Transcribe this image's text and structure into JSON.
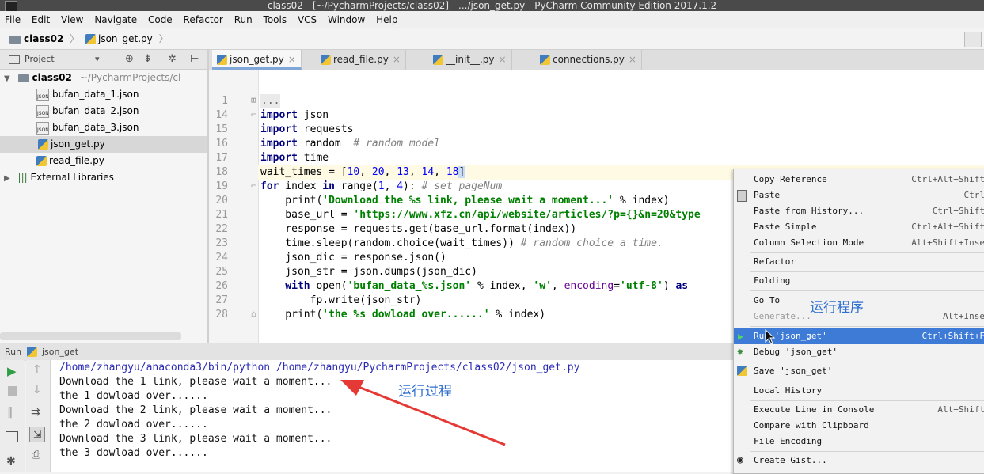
{
  "window": {
    "title": "class02 - [~/PycharmProjects/class02] - .../json_get.py - PyCharm Community Edition 2017.1.2"
  },
  "menu": [
    "File",
    "Edit",
    "View",
    "Navigate",
    "Code",
    "Refactor",
    "Run",
    "Tools",
    "VCS",
    "Window",
    "Help"
  ],
  "breadcrumb": {
    "project": "class02",
    "file": "json_get.py"
  },
  "project_panel": {
    "title": "Project",
    "root": "class02",
    "root_path": "~/PycharmProjects/cl",
    "files": [
      "bufan_data_1.json",
      "bufan_data_2.json",
      "bufan_data_3.json",
      "json_get.py",
      "read_file.py"
    ],
    "external": "External Libraries"
  },
  "tabs": [
    "json_get.py",
    "read_file.py",
    "__init__.py",
    "connections.py"
  ],
  "editor": {
    "line_numbers": [
      "1",
      "14",
      "15",
      "16",
      "17",
      "18",
      "19",
      "20",
      "21",
      "22",
      "23",
      "24",
      "25",
      "26",
      "27",
      "28"
    ],
    "fold": "...",
    "l14": {
      "kw": "import",
      "rest": " json"
    },
    "l15": {
      "kw": "import",
      "rest": " requests"
    },
    "l16": {
      "kw": "import",
      "rest": " random  ",
      "cmt": "# random model"
    },
    "l17": {
      "kw": "import",
      "rest": " time"
    },
    "l18": {
      "a": "wait_times = [",
      "n1": "10",
      "c1": ", ",
      "n2": "20",
      "c2": ", ",
      "n3": "13",
      "c3": ", ",
      "n4": "14",
      "c4": ", ",
      "n5": "18",
      "end": "]"
    },
    "l19": {
      "kw1": "for",
      "a": " index ",
      "kw2": "in",
      "b": " range(",
      "n1": "1",
      "c": ", ",
      "n2": "4",
      "d": "): ",
      "cmt": "# set pageNum"
    },
    "l20": {
      "a": "    print(",
      "s": "'Download the %s link, please wait a moment...'",
      "b": " % index)"
    },
    "l21": {
      "a": "    base_url = ",
      "s": "'https://www.xfz.cn/api/website/articles/?p={}&n=20&type"
    },
    "l22": "    response = requests.get(base_url.format(index))",
    "l23": {
      "a": "    time.sleep(random.choice(wait_times)) ",
      "cmt": "# random choice a time."
    },
    "l24": "    json_dic = response.json()",
    "l25": "    json_str = json.dumps(json_dic)",
    "l26": {
      "kw": "    with",
      "a": " open(",
      "s1": "'bufan_data_%s.json'",
      "b": " % index, ",
      "s2": "'w'",
      "c": ", ",
      "kwarg": "encoding",
      "d": "=",
      "s3": "'utf-8'",
      "e": ") ",
      "kw2": "as"
    },
    "l27": "        fp.write(json_str)",
    "l28": {
      "a": "    print(",
      "s": "'the %s dowload over......'",
      "b": " % index)"
    }
  },
  "run": {
    "title": "Run",
    "config": "json_get",
    "lines": [
      "/home/zhangyu/anaconda3/bin/python /home/zhangyu/PycharmProjects/class02/json_get.py",
      "Download the 1 link, please wait a moment...",
      "the 1 dowload over......",
      "Download the 2 link, please wait a moment...",
      "the 2 dowload over......",
      "Download the 3 link, please wait a moment...",
      "the 3 dowload over......"
    ]
  },
  "context_menu": {
    "items": [
      {
        "label": "Copy Reference",
        "shortcut": "Ctrl+Alt+Shift"
      },
      {
        "label": "Paste",
        "shortcut": "Ctrl"
      },
      {
        "label": "Paste from History...",
        "shortcut": "Ctrl+Shift"
      },
      {
        "label": "Paste Simple",
        "shortcut": "Ctrl+Alt+Shift"
      },
      {
        "label": "Column Selection Mode",
        "shortcut": "Alt+Shift+Inse"
      },
      {
        "label": "Refactor",
        "shortcut": ""
      },
      {
        "label": "Folding",
        "shortcut": ""
      },
      {
        "label": "Go To",
        "shortcut": ""
      },
      {
        "label": "Generate...",
        "shortcut": "Alt+Inse"
      },
      {
        "label": "Run 'json_get'",
        "shortcut": "Ctrl+Shift+F"
      },
      {
        "label": "Debug 'json_get'",
        "shortcut": ""
      },
      {
        "label": "Save 'json_get'",
        "shortcut": ""
      },
      {
        "label": "Local History",
        "shortcut": ""
      },
      {
        "label": "Execute Line in Console",
        "shortcut": "Alt+Shift"
      },
      {
        "label": "Compare with Clipboard",
        "shortcut": ""
      },
      {
        "label": "File Encoding",
        "shortcut": ""
      },
      {
        "label": "Create Gist...",
        "shortcut": ""
      }
    ]
  },
  "annotations": {
    "run_program": "运行程序",
    "run_process": "运行过程"
  },
  "colors": {
    "accent": "#3d7bd6",
    "arrow": "#e53935",
    "annotation": "#2f6fcf"
  }
}
